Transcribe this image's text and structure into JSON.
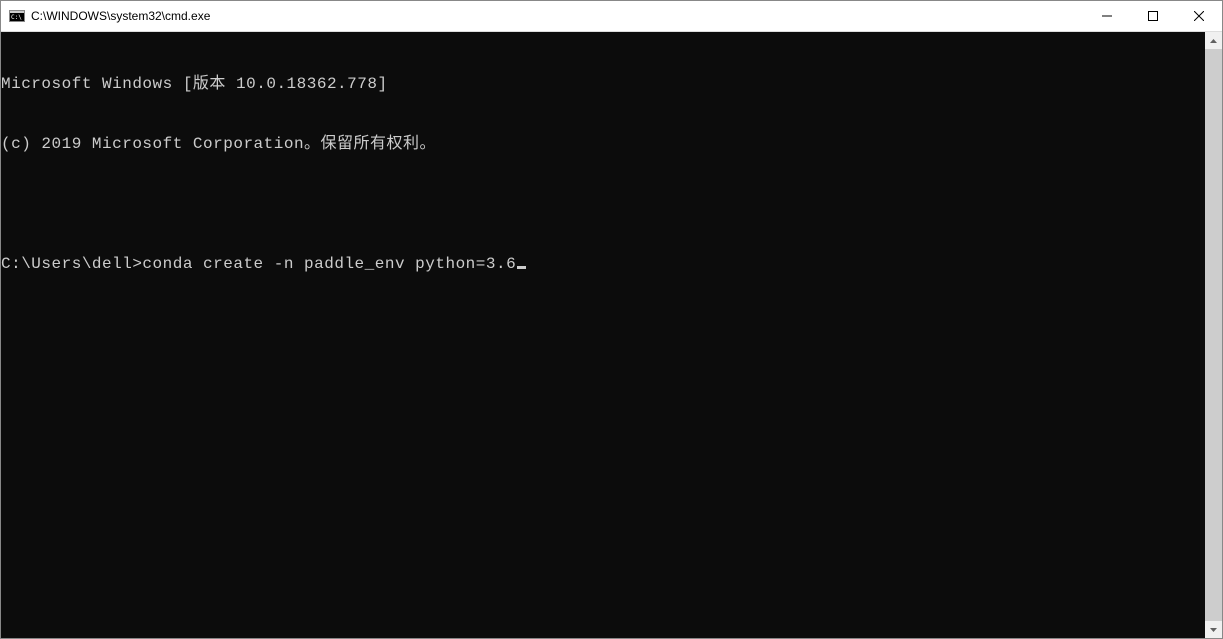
{
  "window": {
    "title": "C:\\WINDOWS\\system32\\cmd.exe"
  },
  "terminal": {
    "lines": [
      "Microsoft Windows [版本 10.0.18362.778]",
      "(c) 2019 Microsoft Corporation。保留所有权利。",
      "",
      "C:\\Users\\dell>conda create -n paddle_env python=3.6"
    ],
    "prompt": "C:\\Users\\dell>",
    "command": "conda create -n paddle_env python=3.6"
  }
}
